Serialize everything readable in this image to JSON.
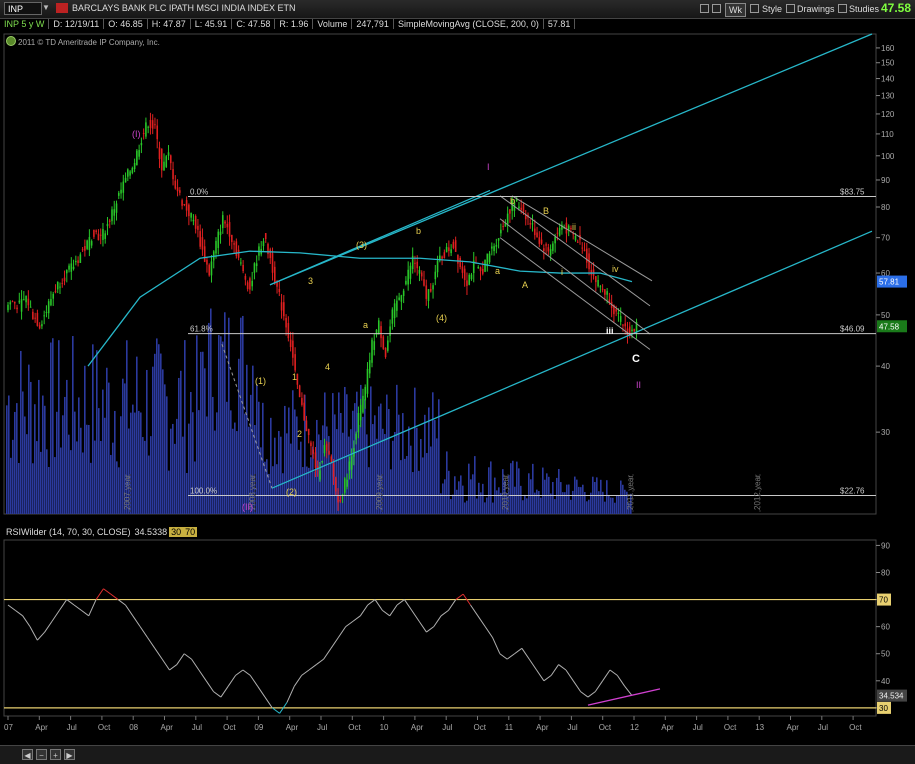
{
  "header": {
    "symbol": "INP",
    "title": "BARCLAYS BANK PLC IPATH MSCI INDIA INDEX ETN",
    "last_price": "47.58",
    "buttons": [
      "Wk",
      "Style",
      "Drawings",
      "Studies"
    ]
  },
  "info": {
    "period": "INP 5 y W",
    "date": "D: 12/19/11",
    "open": "O: 46.85",
    "high": "H: 47.87",
    "low": "L: 45.91",
    "close": "C: 47.58",
    "range": "R: 1.96",
    "volume_label": "Volume",
    "volume": "247,791",
    "sma": "SimpleMovingAvg (CLOSE, 200, 0)",
    "sma_value": "57.81"
  },
  "copyright": "2011 © TD Ameritrade IP Company, Inc.",
  "rsi_header": {
    "study": "RSIWilder (14, 70, 30, CLOSE)",
    "value": "34.5338",
    "ob": "30",
    "os": "70"
  },
  "colors": {
    "background": "#000000",
    "up": "#29c729",
    "down": "#e02020",
    "volume": "#2b3a9e",
    "channel": "#27b7c9",
    "sma": "#27b7c9",
    "rsi": "#b0b0b0",
    "rsi_over": "#e03030",
    "level": "#e8d070",
    "fib": "#c8c8c8",
    "wave_yellow": "#e8d050",
    "wave_magenta": "#cc44cc",
    "wave_white": "#ffffff",
    "last_price": "#7fff3f",
    "sma_label": "#2b6ee8"
  },
  "chart_data": [
    {
      "type": "candlestick",
      "title": "BARCLAYS BANK PLC IPATH MSCI INDIA INDEX ETN",
      "scale": "log",
      "y_ticks": [
        160,
        150,
        140,
        130,
        120,
        110,
        100,
        90,
        80,
        70,
        60,
        50,
        40,
        30
      ],
      "ylim": [
        21,
        170
      ],
      "x_ticks": [
        "07",
        "Apr",
        "Jul",
        "Oct",
        "08",
        "Apr",
        "Jul",
        "Oct",
        "09",
        "Apr",
        "Jul",
        "Oct",
        "10",
        "Apr",
        "Jul",
        "Oct",
        "11",
        "Apr",
        "Jul",
        "Oct",
        "12",
        "Apr",
        "Jul",
        "Oct",
        "13",
        "Apr",
        "Jul",
        "Oct"
      ],
      "year_markers": [
        "2007 year",
        "2008 year",
        "2009 year",
        "2010 year",
        "2011 year",
        "2012 year"
      ],
      "price_labels": [
        {
          "text": "47.58",
          "kind": "last"
        },
        {
          "text": "57.81",
          "kind": "sma"
        }
      ],
      "fib_levels": [
        {
          "label": "0.0%",
          "value": "$83.75",
          "price": 83.75
        },
        {
          "label": "61.8%",
          "value": "$46.09",
          "price": 46.09
        },
        {
          "label": "100.0%",
          "value": "$22.76",
          "price": 22.76
        }
      ],
      "sma_period": 200,
      "weekly_closes": [
        53,
        52,
        54,
        50,
        48,
        51,
        55,
        58,
        60,
        62,
        65,
        68,
        72,
        70,
        74,
        80,
        86,
        92,
        98,
        108,
        116,
        112,
        95,
        100,
        88,
        82,
        78,
        74,
        66,
        60,
        68,
        76,
        72,
        66,
        60,
        56,
        64,
        70,
        64,
        56,
        50,
        44,
        36,
        32,
        28,
        25,
        28,
        26,
        22,
        24,
        27,
        32,
        36,
        44,
        48,
        42,
        50,
        54,
        58,
        64,
        60,
        54,
        58,
        64,
        66,
        68,
        62,
        58,
        62,
        60,
        64,
        68,
        72,
        78,
        82,
        80,
        76,
        72,
        68,
        66,
        70,
        74,
        72,
        70,
        68,
        62,
        58,
        56,
        54,
        50,
        48,
        46,
        47.58
      ],
      "wave_labels": [
        {
          "text": "(I)",
          "color": "magenta"
        },
        {
          "text": "(II)",
          "color": "magenta"
        },
        {
          "text": "I",
          "color": "magenta"
        },
        {
          "text": "II",
          "color": "magenta"
        },
        {
          "text": "(1)",
          "color": "yellow"
        },
        {
          "text": "(2)",
          "color": "yellow"
        },
        {
          "text": "(3)",
          "color": "yellow"
        },
        {
          "text": "(4)",
          "color": "yellow"
        },
        {
          "text": "1",
          "color": "yellow"
        },
        {
          "text": "2",
          "color": "yellow"
        },
        {
          "text": "3",
          "color": "yellow"
        },
        {
          "text": "4",
          "color": "yellow"
        },
        {
          "text": "a",
          "color": "yellow"
        },
        {
          "text": "b",
          "color": "yellow"
        },
        {
          "text": "a",
          "color": "yellow"
        },
        {
          "text": "b",
          "color": "yellow"
        },
        {
          "text": "A",
          "color": "yellow"
        },
        {
          "text": "B",
          "color": "yellow"
        },
        {
          "text": "C",
          "color": "white"
        },
        {
          "text": "i",
          "color": "yellow"
        },
        {
          "text": "ii",
          "color": "yellow"
        },
        {
          "text": "iii",
          "color": "white"
        },
        {
          "text": "iv",
          "color": "yellow"
        }
      ]
    },
    {
      "type": "line",
      "title": "RSIWilder (14, 70, 30, CLOSE)",
      "y_ticks": [
        90,
        80,
        70,
        60,
        50,
        40,
        30
      ],
      "ylim": [
        27,
        92
      ],
      "levels": [
        70,
        30
      ],
      "last_value": "34.534",
      "values": [
        68,
        66,
        64,
        60,
        55,
        58,
        62,
        66,
        70,
        68,
        66,
        64,
        70,
        74,
        72,
        70,
        68,
        64,
        60,
        56,
        52,
        48,
        44,
        46,
        50,
        48,
        44,
        40,
        36,
        34,
        38,
        42,
        44,
        42,
        38,
        34,
        30,
        28,
        32,
        38,
        42,
        44,
        46,
        48,
        52,
        56,
        60,
        62,
        64,
        68,
        70,
        66,
        64,
        68,
        70,
        66,
        62,
        58,
        60,
        64,
        66,
        70,
        72,
        68,
        64,
        60,
        56,
        50,
        48,
        50,
        52,
        48,
        44,
        40,
        42,
        46,
        44,
        40,
        36,
        34,
        36,
        40,
        44,
        42,
        38,
        34.534
      ]
    }
  ]
}
